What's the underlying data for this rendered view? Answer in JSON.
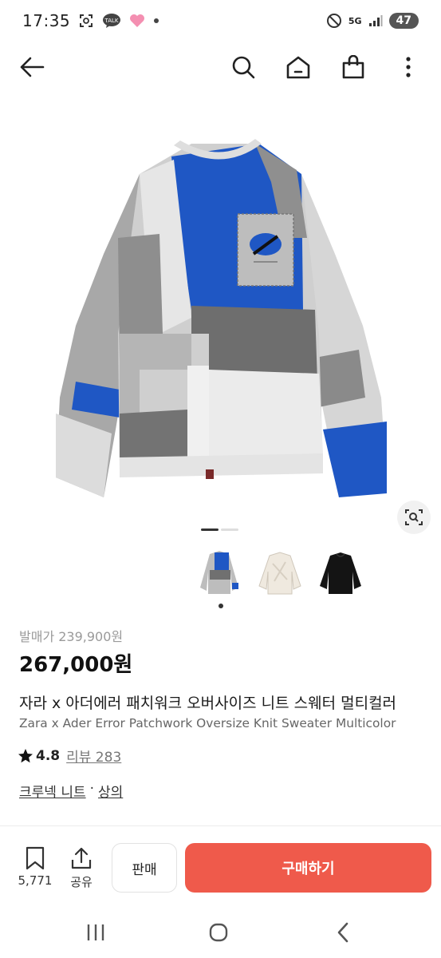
{
  "status_bar": {
    "time": "17:35",
    "talk_badge": "TALK",
    "network": "5G",
    "battery": "47"
  },
  "icons": {
    "back": "back-arrow-icon",
    "search": "search-icon",
    "home": "home-icon",
    "bag": "shopping-bag-icon",
    "more": "more-vertical-icon",
    "lens": "image-search-icon",
    "wish": "bookmark-icon",
    "share": "share-icon"
  },
  "gallery": {
    "page_count": 2,
    "active_page": 1,
    "thumbnails": [
      "multicolor",
      "cream",
      "black"
    ],
    "selected_thumbnail": 0
  },
  "product": {
    "original_price": "발매가 239,900원",
    "price": "267,000원",
    "title_ko": "자라 x 아더에러 패치워크 오버사이즈 니트 스웨터 멀티컬러",
    "title_en": "Zara x Ader Error Patchwork Oversize Knit Sweater Multicolor",
    "rating": "4.8",
    "review_label": "리뷰 283",
    "category_1": "크루넥 니트",
    "category_sep": "·",
    "category_2": "상의"
  },
  "actions": {
    "wish_count": "5,771",
    "share_label": "공유",
    "sell_label": "판매",
    "buy_label": "구매하기"
  },
  "colors": {
    "accent": "#ef5a4b",
    "sweater_blue": "#1f57c4"
  }
}
